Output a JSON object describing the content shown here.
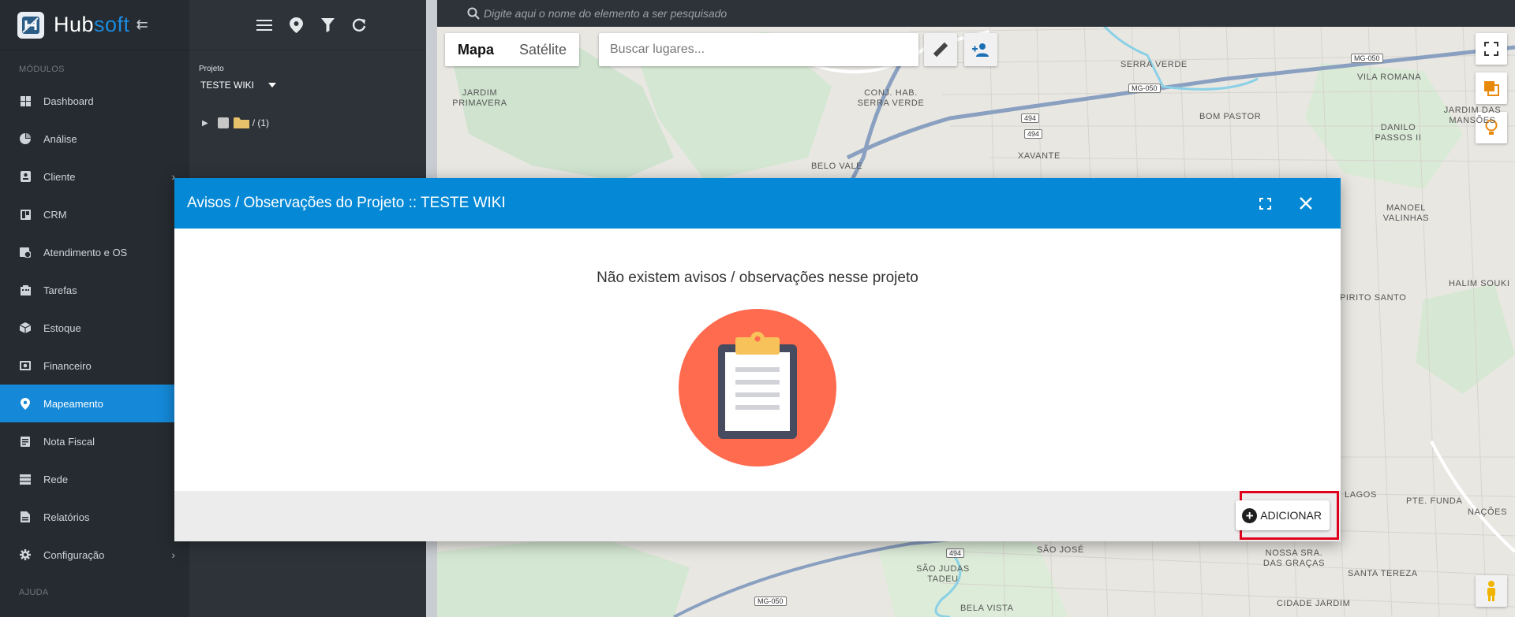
{
  "brand": {
    "name_part1": "Hub",
    "name_part2": "soft"
  },
  "sidebar": {
    "section_label": "MÓDULOS",
    "items": [
      {
        "label": "Dashboard",
        "icon": "dashboard-icon"
      },
      {
        "label": "Análise",
        "icon": "pie-chart-icon"
      },
      {
        "label": "Cliente",
        "icon": "contact-card-icon",
        "has_submenu": true
      },
      {
        "label": "CRM",
        "icon": "crm-board-icon"
      },
      {
        "label": "Atendimento e OS",
        "icon": "calendar-clock-icon"
      },
      {
        "label": "Tarefas",
        "icon": "tasks-building-icon"
      },
      {
        "label": "Estoque",
        "icon": "box-icon"
      },
      {
        "label": "Financeiro",
        "icon": "money-icon"
      },
      {
        "label": "Mapeamento",
        "icon": "map-pin-icon",
        "active": true
      },
      {
        "label": "Nota Fiscal",
        "icon": "invoice-icon"
      },
      {
        "label": "Rede",
        "icon": "server-icon"
      },
      {
        "label": "Relatórios",
        "icon": "report-icon"
      },
      {
        "label": "Configuração",
        "icon": "gear-icon",
        "has_submenu": true
      }
    ],
    "help_label": "AJUDA"
  },
  "panel": {
    "project_label": "Projeto",
    "project_value": "TESTE WIKI",
    "tree_root": "/ (1)"
  },
  "map": {
    "search_placeholder": "Digite aqui o nome do elemento a ser pesquisado",
    "tabs": [
      "Mapa",
      "Satélite"
    ],
    "places_placeholder": "Buscar lugares...",
    "labels": [
      "SERRA VERDE",
      "VILA ROMANA",
      "JARDIM PRIMAVERA",
      "CONJ. HAB. SERRA VERDE",
      "BOM PASTOR",
      "DANILO PASSOS II",
      "JARDIM DAS MANSÕES",
      "BELO VALE",
      "XAVANTE",
      "MANOEL VALINHAS",
      "HALIM SOUKI",
      "SÃO JOSÉ",
      "SÃO JUDAS TADEU",
      "NOSSA SRA. DAS GRAÇAS",
      "SANTA TEREZA",
      "BELA VISTA",
      "CIDADE JARDIM",
      "PTE. FUNDA",
      "NAÇÕES",
      "PIRITO SANTO",
      "LAGOS"
    ],
    "road_shields": [
      "MG-050",
      "MG-050",
      "494",
      "494",
      "494",
      "MG-050"
    ]
  },
  "modal": {
    "title": "Avisos / Observações do Projeto :: TESTE WIKI",
    "empty_message": "Não existem avisos / observações nesse projeto",
    "add_label": "ADICIONAR"
  },
  "colors": {
    "sidebar_bg": "#262b31",
    "active_item": "#1589d8",
    "modal_header": "#0589d6",
    "illustration_circle": "#ff6b4f",
    "highlight_border": "#e0001b"
  }
}
